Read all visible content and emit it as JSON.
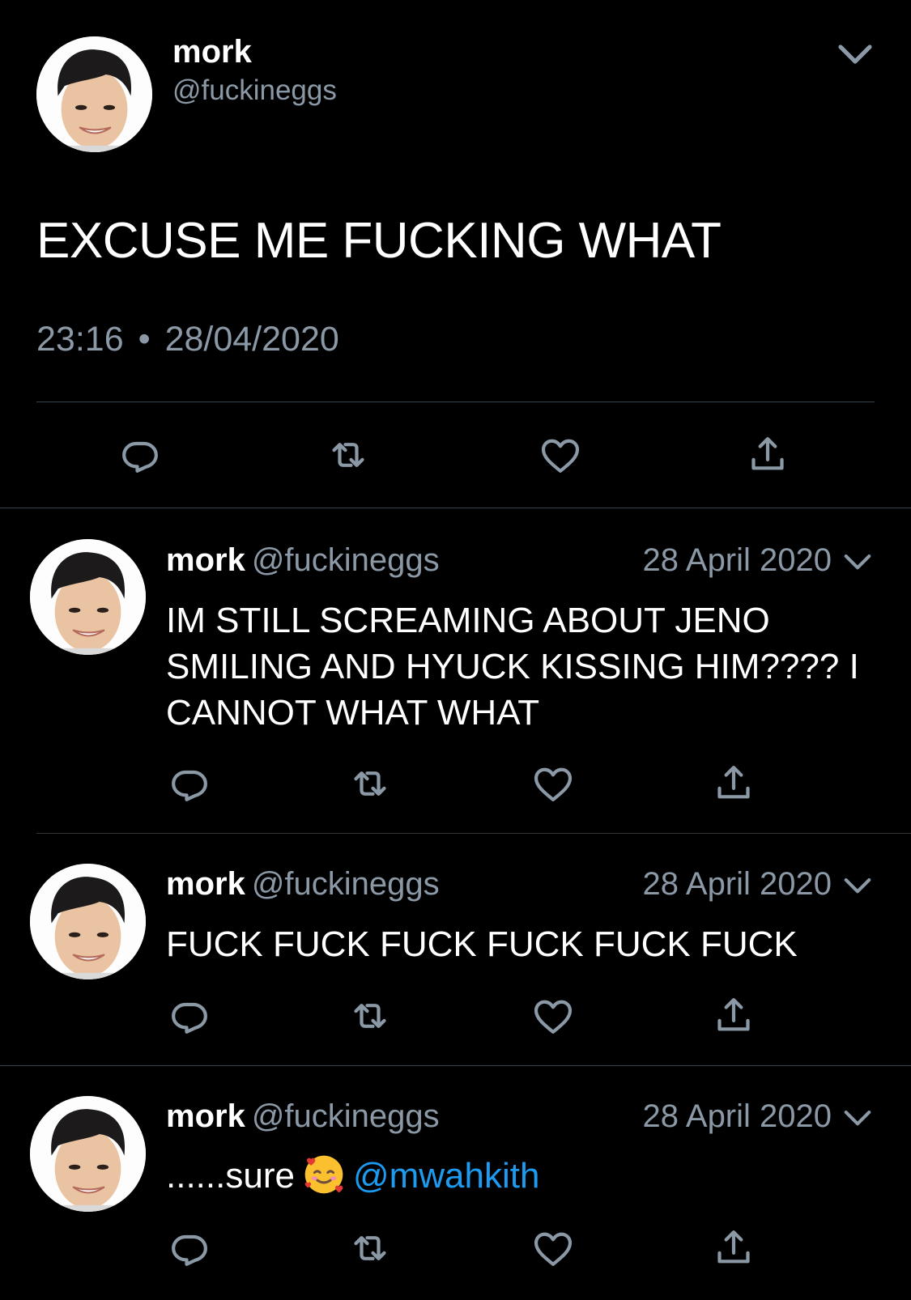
{
  "main_tweet": {
    "name": "mork",
    "handle": "@fuckineggs",
    "text": "EXCUSE ME FUCKING WHAT",
    "time": "23:16",
    "separator": "•",
    "date": "28/04/2020"
  },
  "replies": [
    {
      "name": "mork",
      "handle": "@fuckineggs",
      "date": "28 April 2020",
      "text": "IM STILL SCREAMING ABOUT JENO SMILING AND HYUCK KISSING HIM???? I CANNOT WHAT WHAT"
    },
    {
      "name": "mork",
      "handle": "@fuckineggs",
      "date": "28 April 2020",
      "text": "FUCK FUCK FUCK FUCK FUCK FUCK"
    },
    {
      "name": "mork",
      "handle": "@fuckineggs",
      "date": "28 April 2020",
      "text_before": "......sure",
      "emoji": "smiling-face-with-hearts",
      "mention": "@mwahkith"
    }
  ],
  "icons": {
    "reply": "reply-icon",
    "retweet": "retweet-icon",
    "like": "heart-icon",
    "share": "share-icon",
    "more": "chevron-down-icon"
  },
  "colors": {
    "background": "#000000",
    "text": "#ffffff",
    "secondary": "#8b98a5",
    "mention": "#1d9bf0",
    "divider": "#38444d"
  }
}
